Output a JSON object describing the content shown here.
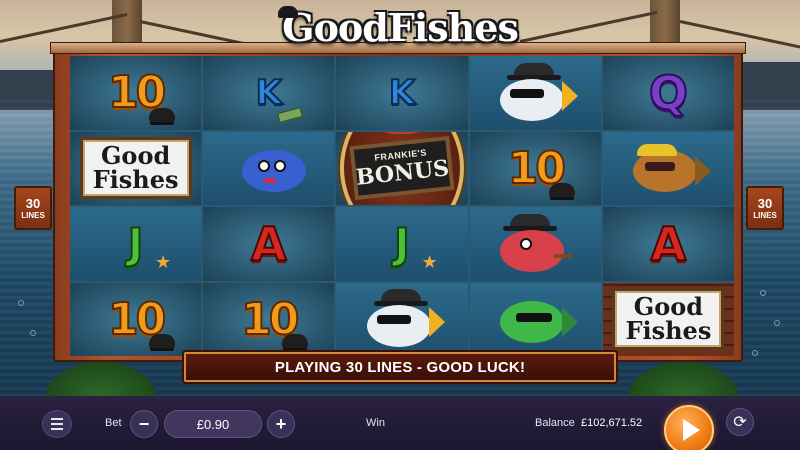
{
  "game": {
    "title": "GoodFishes"
  },
  "reels": [
    [
      {
        "symbol": "ten",
        "text": "10"
      },
      {
        "symbol": "good-fishes",
        "text_1": "Good",
        "text_2": "Fishes"
      },
      {
        "symbol": "jack",
        "text": "J"
      },
      {
        "symbol": "ten",
        "text": "10"
      }
    ],
    [
      {
        "symbol": "king",
        "text": "K"
      },
      {
        "symbol": "blue-fish-lady"
      },
      {
        "symbol": "ace",
        "text": "A"
      },
      {
        "symbol": "ten",
        "text": "10"
      }
    ],
    [
      {
        "symbol": "king",
        "text": "K"
      },
      {
        "symbol": "frankies-bonus",
        "text_1": "FRANKIE'S",
        "text_2": "BONUS"
      },
      {
        "symbol": "jack",
        "text": "J"
      },
      {
        "symbol": "white-fish-gangster"
      }
    ],
    [
      {
        "symbol": "white-fish-gangster"
      },
      {
        "symbol": "ten",
        "text": "10"
      },
      {
        "symbol": "red-fish-cigar"
      },
      {
        "symbol": "green-fish-shades"
      }
    ],
    [
      {
        "symbol": "queen",
        "text": "Q"
      },
      {
        "symbol": "golden-fish-cap"
      },
      {
        "symbol": "ace",
        "text": "A"
      },
      {
        "symbol": "good-fishes",
        "text_1": "Good",
        "text_2": "Fishes"
      }
    ]
  ],
  "lines_left": {
    "number": "30",
    "label": "LINES"
  },
  "lines_right": {
    "number": "30",
    "label": "LINES"
  },
  "message": "PLAYING 30 LINES - GOOD LUCK!",
  "controls": {
    "bet_label": "Bet",
    "bet_value": "£0.90",
    "decrease_symbol": "−",
    "increase_symbol": "+",
    "win_label": "Win",
    "balance_label": "Balance",
    "balance_value": "£102,671.52"
  },
  "colors": {
    "frame": "#b4532a",
    "control_bar": "#2a2240",
    "spin_button": "#f07a12",
    "message_border": "#d08a3a"
  },
  "icons": {
    "menu": "hamburger-icon",
    "spin": "play-icon",
    "autoplay": "autoplay-icon"
  }
}
